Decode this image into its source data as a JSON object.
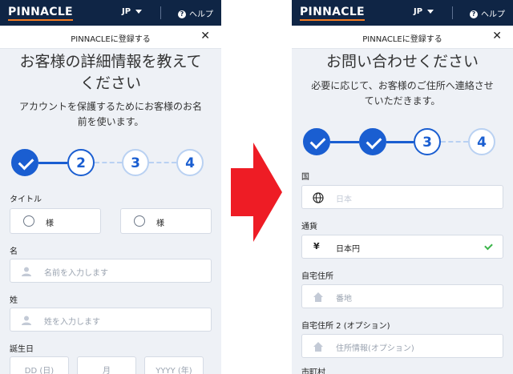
{
  "header": {
    "logo": "PINNACLE",
    "language": "JP",
    "help": "ヘルプ"
  },
  "register_bar": {
    "title": "PINNACLEに登録する",
    "close": "✕"
  },
  "left_screen": {
    "heading_line1": "お客様の詳細情報を教えて",
    "heading_line2": "ください",
    "subtitle_line1": "アカウントを保護するためにお客様のお名",
    "subtitle_line2": "前を使います。",
    "steps": [
      "2",
      "3",
      "4"
    ],
    "title_label": "タイトル",
    "title_options": [
      "様",
      "様"
    ],
    "first_name_label": "名",
    "first_name_placeholder": "名前を入力します",
    "last_name_label": "姓",
    "last_name_placeholder": "姓を入力します",
    "dob_label": "誕生日",
    "dob_day": "DD (日)",
    "dob_month": "月",
    "dob_year": "YYYY (年)"
  },
  "right_screen": {
    "heading": "お問い合わせください",
    "subtitle_line1": "必要に応じて、お客様のご住所へ連絡させ",
    "subtitle_line2": "ていただきます。",
    "steps": [
      "3",
      "4"
    ],
    "country_label": "国",
    "country_value": "日本",
    "currency_label": "通貨",
    "currency_symbol": "¥",
    "currency_value": "日本円",
    "address_label": "自宅住所",
    "address_placeholder": "番地",
    "address2_label": "自宅住所 2 (オプション)",
    "address2_placeholder": "住所情報(オプション)",
    "city_label": "市町村"
  },
  "colors": {
    "accent": "#1a5ed1",
    "header_bg": "#0f2545",
    "arrow": "#ee1c25",
    "logo_underline": "#f47a20"
  }
}
